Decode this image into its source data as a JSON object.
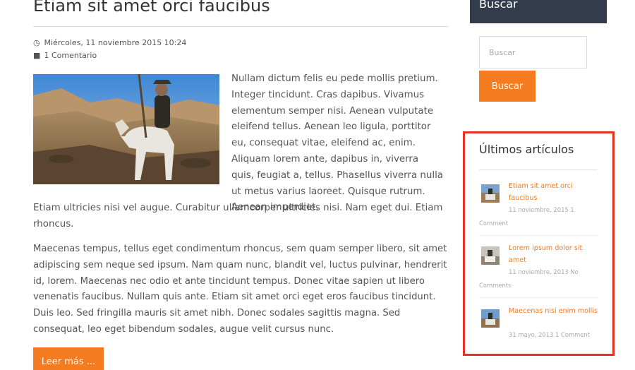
{
  "article": {
    "title": "Etiam sit amet orci faucibus",
    "date": "Miércoles, 11 noviembre 2015 10:24",
    "comments": "1 Comentario",
    "paragraph_wrap": "Nullam dictum felis eu pede mollis pretium. Integer tincidunt. Cras dapibus. Vivamus elementum semper nisi. Aenean vulputate eleifend tellus. Aenean leo ligula, porttitor eu, consequat vitae, eleifend ac, enim. Aliquam lorem ante, dapibus in, viverra quis, feugiat a, tellus. Phasellus viverra nulla ut metus varius laoreet. Quisque rutrum. Aenean imperdiet.",
    "paragraph_cont": "Etiam ultricies nisi vel augue. Curabitur ullamcorper ultricies nisi. Nam eget dui. Etiam rhoncus.",
    "paragraph_2": "Maecenas tempus, tellus eget condimentum rhoncus, sem quam semper libero, sit amet adipiscing sem neque sed ipsum. Nam quam nunc, blandit vel, luctus pulvinar, hendrerit id, lorem. Maecenas nec odio et ante tincidunt tempus. Donec vitae sapien ut libero venenatis faucibus. Nullam quis ante. Etiam sit amet orci eget eros faucibus tincidunt. Duis leo. Sed fringilla mauris sit amet nibh. Donec sodales sagittis magna. Sed consequat, leo eget bibendum sodales, augue velit cursus nunc.",
    "read_more_label": "Leer más ...",
    "icons": {
      "date": "clock-icon",
      "comments": "comments-icon"
    }
  },
  "sidebar": {
    "search": {
      "header": "Buscar",
      "placeholder": "Buscar",
      "button_label": "Buscar"
    },
    "latest": {
      "title": "Últimos artículos",
      "posts": [
        {
          "title": "Etiam sit amet orci faucibus",
          "meta": "11 noviembre, 2015 1 Comment"
        },
        {
          "title": "Lorem ipsum dolor sit amet",
          "meta": "11 noviembre, 2013 No Comments"
        },
        {
          "title": "Maecenas nisi enim mollis",
          "meta": "31 mayo, 2013 1 Comment"
        }
      ]
    }
  },
  "colors": {
    "accent": "#f47b20",
    "sidebar_header_bg": "#333c4a",
    "highlight_border": "#e63223",
    "text": "#555555"
  }
}
